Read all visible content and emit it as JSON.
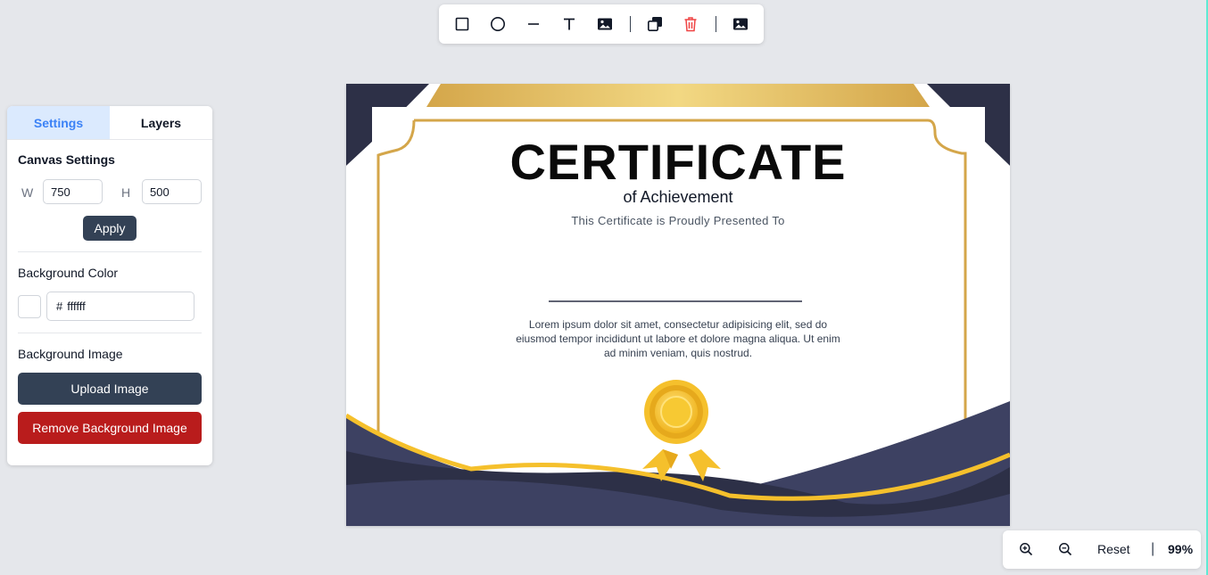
{
  "toolbar": {
    "tools": [
      {
        "name": "rectangle-icon"
      },
      {
        "name": "circle-icon"
      },
      {
        "name": "line-icon"
      },
      {
        "name": "text-icon"
      },
      {
        "name": "image-icon"
      },
      {
        "name": "duplicate-icon"
      },
      {
        "name": "trash-icon"
      },
      {
        "name": "background-image-icon"
      }
    ],
    "separator": "|",
    "delete_color": "#ef4444"
  },
  "panel": {
    "tabs": [
      "Settings",
      "Layers"
    ],
    "active_tab": "Settings",
    "canvas_settings_title": "Canvas Settings",
    "width_label": "W",
    "width_value": "750",
    "height_label": "H",
    "height_value": "500",
    "apply_label": "Apply",
    "bg_color_title": "Background Color",
    "bg_color_hash": "#",
    "bg_color_value": "ffffff",
    "bg_image_title": "Background Image",
    "upload_label": "Upload Image",
    "remove_label": "Remove Background Image",
    "colors": {
      "tab_active_bg": "#dbeafe",
      "tab_active_text": "#3b82f6",
      "primary": "#334155",
      "danger": "#b91c1c"
    }
  },
  "certificate": {
    "title": "CERTIFICATE",
    "subtitle": "of Achievement",
    "presented": "This Certificate is Proudly Presented To",
    "body_line1": "Lorem ipsum dolor sit amet, consectetur adipisicing elit, sed do",
    "body_line2": "eiusmod tempor incididunt ut labore et dolore magna aliqua. Ut enim",
    "body_line3": "ad minim veniam, quis nostrud.",
    "colors": {
      "navy": "#2d3047",
      "navy_light": "#3d4162",
      "gold": "#d4a64a",
      "gold_light": "#f2d883",
      "ribbon": "#f5c02c"
    }
  },
  "zoom": {
    "zoom_in_icon": "zoom-in-icon",
    "zoom_out_icon": "zoom-out-icon",
    "reset_label": "Reset",
    "separator": "|",
    "level": "99%"
  }
}
